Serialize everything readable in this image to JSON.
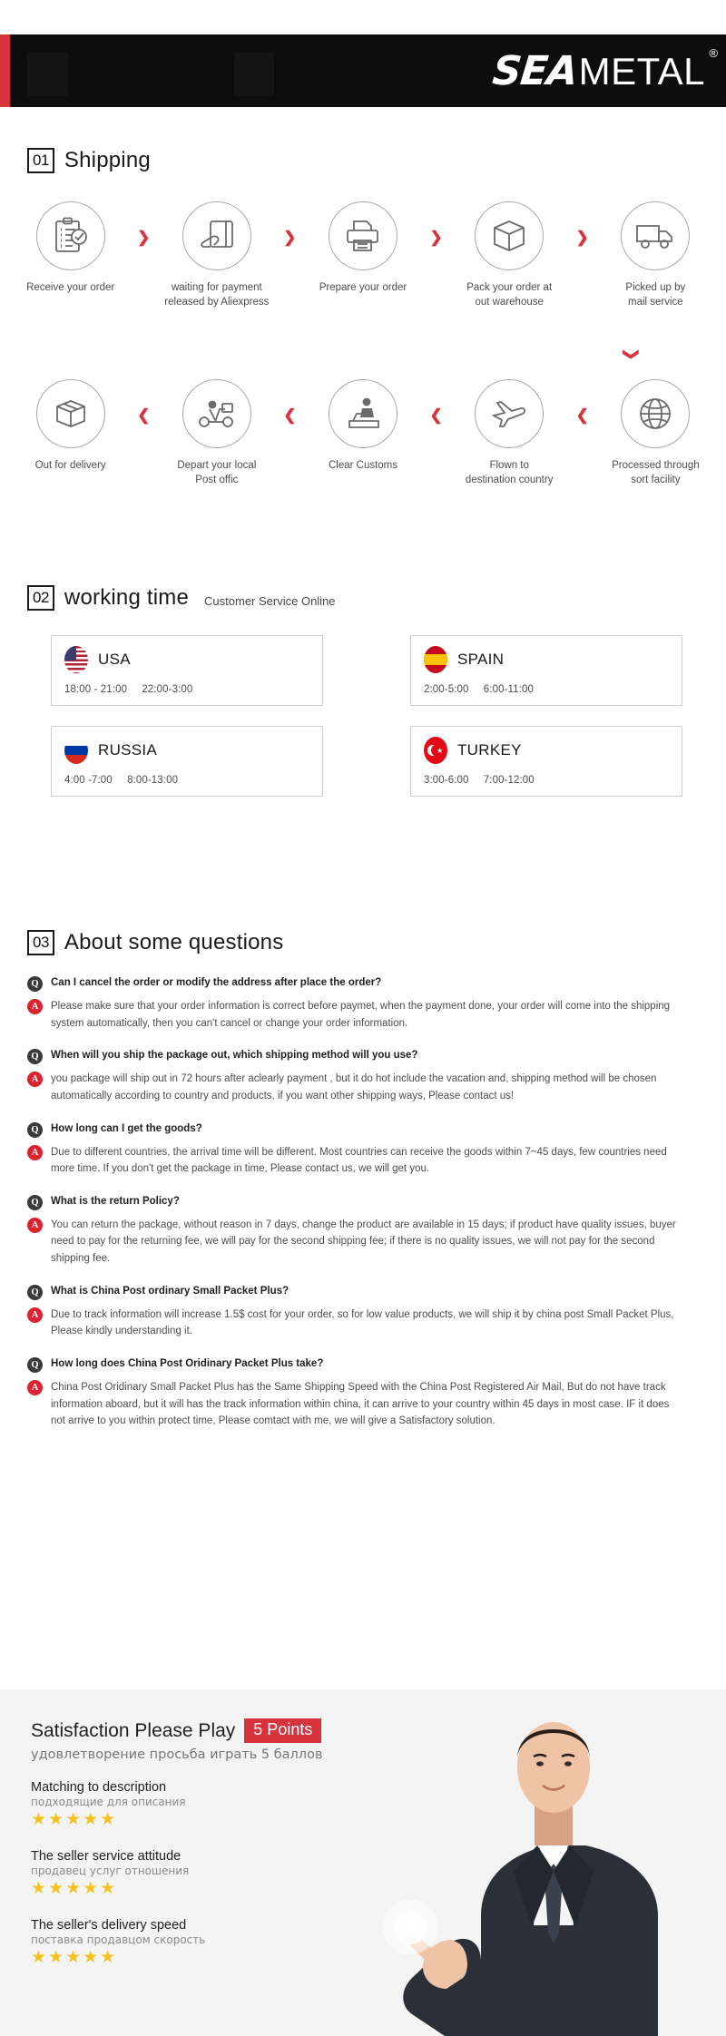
{
  "brand": {
    "logo_primary": "SEA",
    "logo_secondary": "METAL",
    "registered_mark": "®",
    "accent_color": "#d8323e",
    "header_bg": "#0d0d0d"
  },
  "sections": {
    "shipping": {
      "number": "01",
      "label": "Shipping",
      "arrow_glyph": "❯",
      "arrow_left_glyph": "❮",
      "arrow_down_glyph": "❯",
      "row1": [
        {
          "icon": "clipboard-check-icon",
          "lines": [
            "Receive your order"
          ]
        },
        {
          "icon": "hand-credit-card-icon",
          "lines": [
            "waiting for payment",
            "released by Aliexpress"
          ]
        },
        {
          "icon": "printer-icon",
          "lines": [
            "Prepare your order"
          ]
        },
        {
          "icon": "box-package-icon",
          "lines": [
            "Pack your order at",
            "out warehouse"
          ]
        },
        {
          "icon": "delivery-truck-icon",
          "lines": [
            "Picked up by",
            "mail service"
          ]
        }
      ],
      "row2": [
        {
          "icon": "open-box-icon",
          "lines": [
            "Out  for delivery"
          ]
        },
        {
          "icon": "scooter-courier-icon",
          "lines": [
            "Depart your local",
            "Post offic"
          ]
        },
        {
          "icon": "customs-inspector-icon",
          "lines": [
            "Clear Customs"
          ]
        },
        {
          "icon": "airplane-icon",
          "lines": [
            "Flown to",
            "destination country"
          ]
        },
        {
          "icon": "globe-icon",
          "lines": [
            "Processed through",
            "sort facility"
          ]
        }
      ]
    },
    "working_time": {
      "number": "02",
      "label": "working time",
      "subtitle": "Customer Service Online",
      "cards": [
        {
          "flag": "flag-usa-icon",
          "country": "USA",
          "hours": [
            "18:00 - 21:00",
            "22:00-3:00"
          ]
        },
        {
          "flag": "flag-spain-icon",
          "country": "SPAIN",
          "hours": [
            "2:00-5:00",
            "6:00-11:00"
          ]
        },
        {
          "flag": "flag-russia-icon",
          "country": "RUSSIA",
          "hours": [
            "4:00 -7:00",
            "8:00-13:00"
          ]
        },
        {
          "flag": "flag-turkey-icon",
          "country": "TURKEY",
          "hours": [
            "3:00-6:00",
            "7:00-12:00"
          ]
        }
      ]
    },
    "faq": {
      "number": "03",
      "label": "About some questions",
      "q_badge": "Q",
      "a_badge": "A",
      "items": [
        {
          "question": "Can I cancel the order or modify the address after place the order?",
          "answer": "Please make sure that your order information is correct before paymet, when the payment done, your order will come into the shipping system automatically, then you can't cancel or change your order information."
        },
        {
          "question": "When will you ship the package out, which shipping method will you use?",
          "answer": "you package will ship out in 72 hours after aclearly payment , but it do hot include the vacation and, shipping method will be chosen automatically according to country and products, if you want other shipping ways, Please contact us!"
        },
        {
          "question": "How long can I get the goods?",
          "answer": "Due to different countries, the arrival time will be different. Most countries can receive the goods within 7~45 days, few countries need more time. If you don't get the package in time, Please contact us, we will get you."
        },
        {
          "question": "What is the return Policy?",
          "answer": "You can return the package, without reason in 7 days, change the product are available in 15 days; if product have quality issues, buyer need to pay for the returning fee, we will pay for the second shipping fee; if there is no quality issues, we will not pay for the second shipping fee."
        },
        {
          "question": "What is China Post ordinary Small Packet Plus?",
          "answer": "Due to track information will increase 1.5$ cost for your order, so for low value products, we will ship it by china post Small Packet Plus, Please kindly understanding it."
        },
        {
          "question": "How long does China Post Oridinary Packet Plus take?",
          "answer": "China Post Oridinary Small Packet Plus has the Same Shipping Speed with the China Post Registered Air Mail, But do not have track information aboard, but it will has the track information within china, it can arrive to your country within 45 days in most case. IF it does not arrive to you within protect time, Please comtact with me, we will give a Satisfactory solution."
        }
      ]
    },
    "satisfaction": {
      "title": "Satisfaction Please Play",
      "points_badge": "5 Points",
      "subtitle_ru": "удовлетворение просьба играть 5 баллов",
      "star_glyph": "★",
      "star_color": "#f5c220",
      "ratings": [
        {
          "en": "Matching to description",
          "ru": "подходящие для описания",
          "stars": "★★★★★"
        },
        {
          "en": "The seller service attitude",
          "ru": "продавец услуг отношения",
          "stars": "★★★★★"
        },
        {
          "en": "The seller's delivery speed",
          "ru": "поставка продавцом скорость",
          "stars": "★★★★★"
        }
      ]
    }
  }
}
